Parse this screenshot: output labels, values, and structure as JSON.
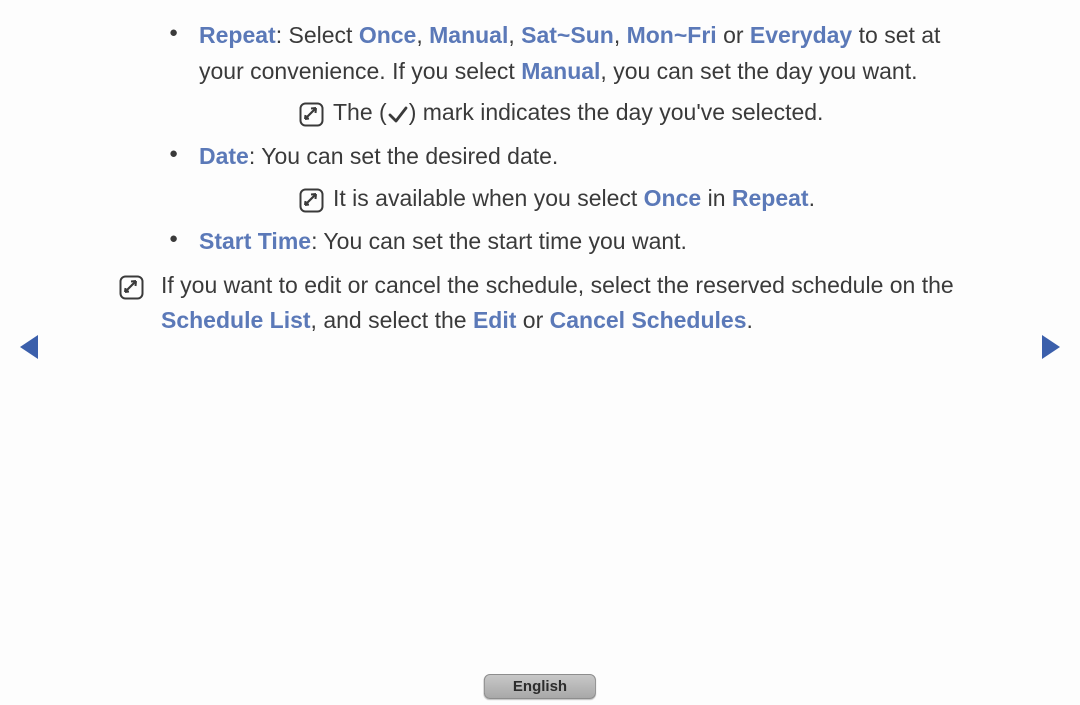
{
  "bullets": {
    "repeat": {
      "label": "Repeat",
      "pre": ": Select ",
      "opt1": "Once",
      "sep1": ", ",
      "opt2": "Manual",
      "sep2": ", ",
      "opt3": "Sat~Sun",
      "sep3": ", ",
      "opt4": "Mon~Fri",
      "sep4": " or ",
      "opt5": "Everyday",
      "tail1": " to set at your convenience. If you select ",
      "opt6": "Manual",
      "tail2": ", you can set the day you want.",
      "note_a": "The (",
      "note_b": ") mark indicates the day you've selected."
    },
    "date": {
      "label": "Date",
      "text": ": You can set the desired date.",
      "note_a": "It is available when you select ",
      "hl1": "Once",
      "mid": " in ",
      "hl2": "Repeat",
      "tail": "."
    },
    "start": {
      "label": "Start Time",
      "text": ": You can set the start time you want."
    }
  },
  "outer_note": {
    "a": "If you want to edit or cancel the schedule, select the reserved schedule on the ",
    "hl1": "Schedule List",
    "b": ", and select the ",
    "hl2": "Edit",
    "c": " or ",
    "hl3": "Cancel Schedules",
    "d": "."
  },
  "footer": {
    "language": "English"
  }
}
